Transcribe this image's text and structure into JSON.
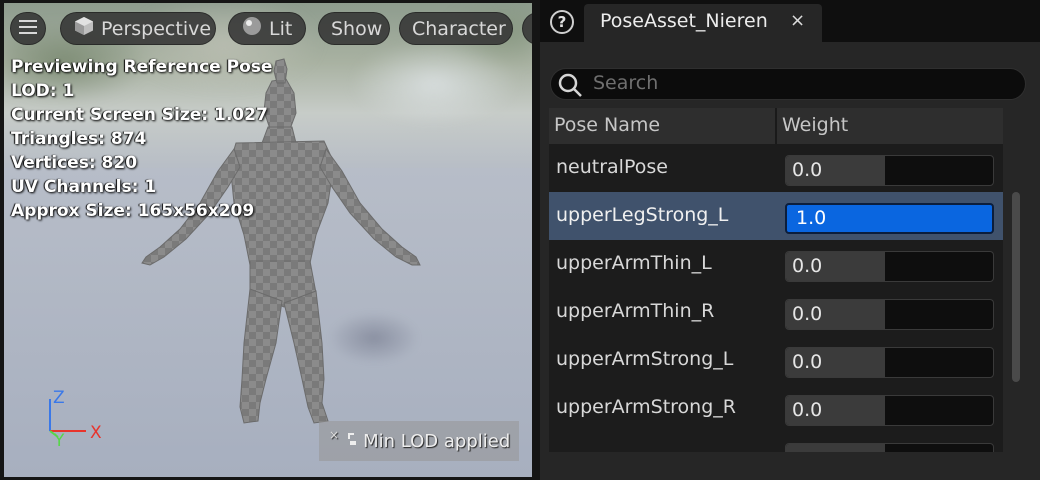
{
  "viewport": {
    "toolbar": {
      "perspective_label": "Perspective",
      "lit_label": "Lit",
      "show_label": "Show",
      "character_label": "Character"
    },
    "stats": [
      "Previewing Reference Pose",
      "LOD: 1",
      "Current Screen Size: 1.027",
      "Triangles: 874",
      "Vertices: 820",
      "UV Channels: 1",
      "Approx Size: 165x56x209"
    ],
    "axes": {
      "z": "Z",
      "y": "Y",
      "x": "X"
    },
    "toast": {
      "close": "×",
      "text": "Min LOD applied"
    }
  },
  "panel": {
    "help": "?",
    "tab": {
      "title": "PoseAsset_Nieren",
      "close": "×"
    },
    "search": {
      "placeholder": "Search"
    },
    "columns": {
      "name": "Pose Name",
      "weight": "Weight"
    },
    "rows": [
      {
        "name": "neutralPose",
        "weight": "0.0",
        "fill": 0.48
      },
      {
        "name": "upperLegStrong_L",
        "weight": "1.0",
        "fill": 1.0,
        "selected": true
      },
      {
        "name": "upperArmThin_L",
        "weight": "0.0",
        "fill": 0.48
      },
      {
        "name": "upperArmThin_R",
        "weight": "0.0",
        "fill": 0.48
      },
      {
        "name": "upperArmStrong_L",
        "weight": "0.0",
        "fill": 0.48
      },
      {
        "name": "upperArmStrong_R",
        "weight": "0.0",
        "fill": 0.48
      },
      {
        "name": "",
        "weight": "",
        "fill": 0.48
      }
    ]
  },
  "colors": {
    "axis_x": "#e8342c",
    "axis_y": "#58d64a",
    "axis_z": "#3a78e8",
    "selection": "#40526c",
    "slider_active": "#0a66e0"
  }
}
